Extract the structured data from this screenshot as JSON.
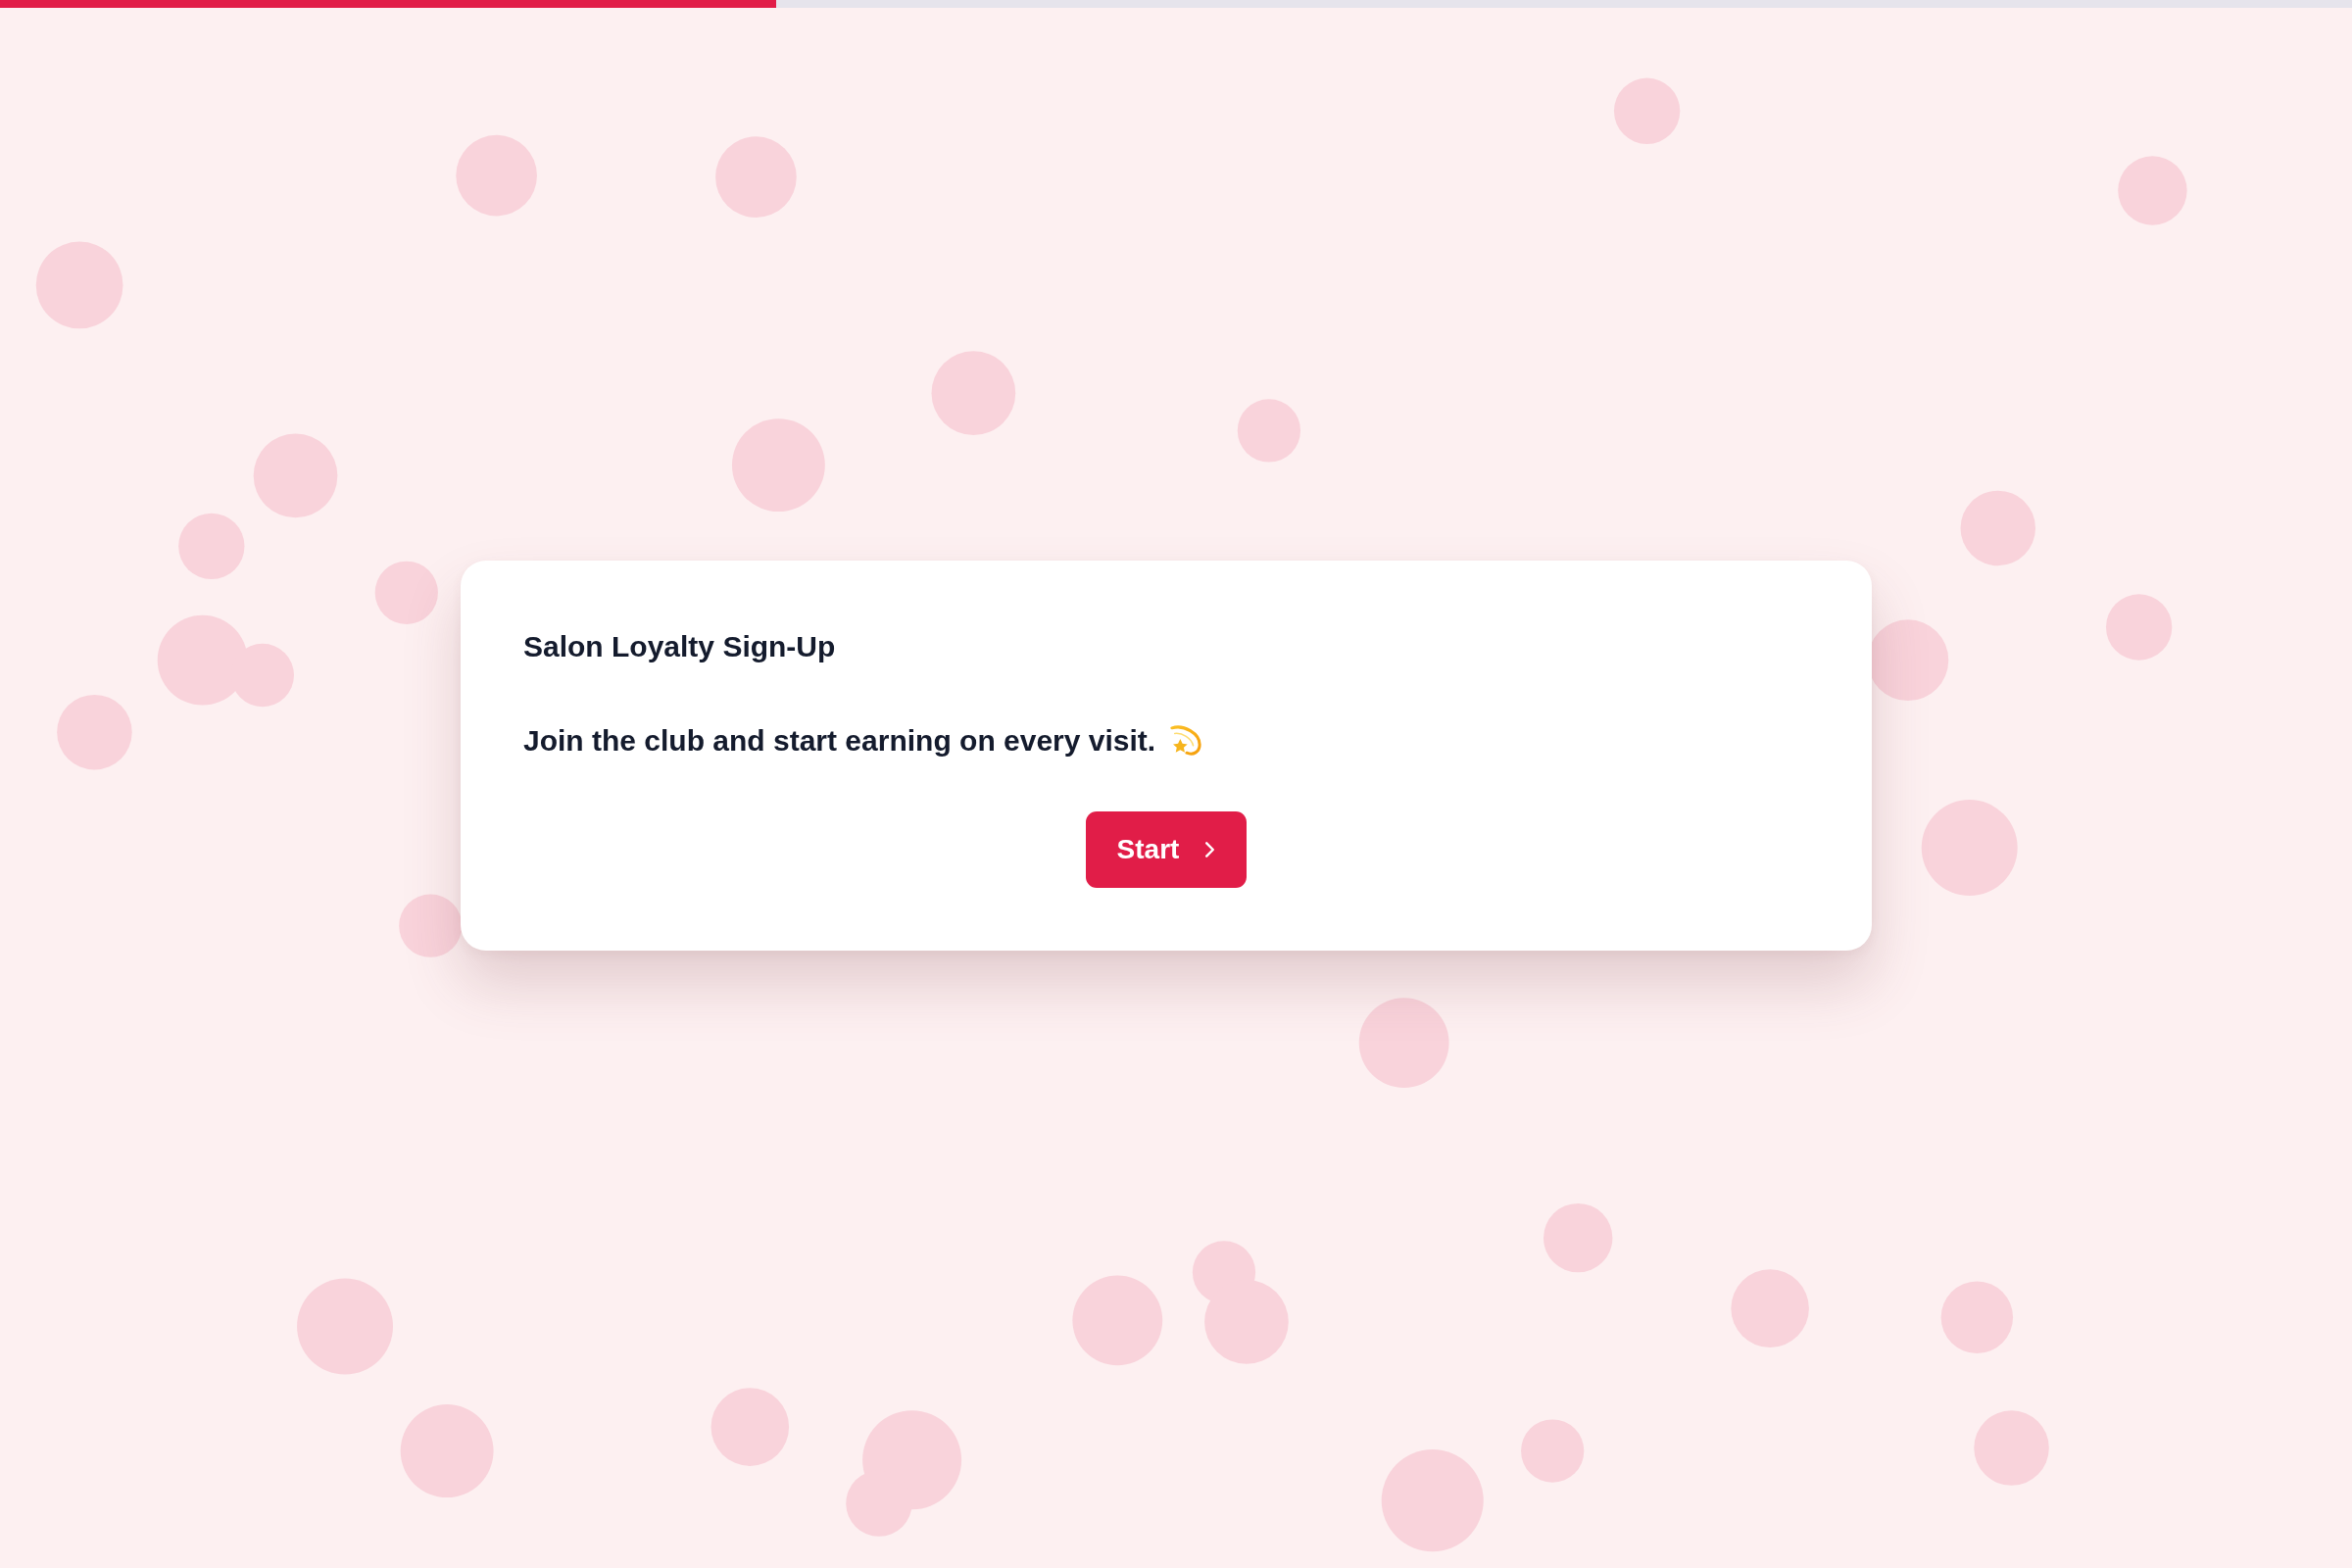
{
  "progress": {
    "level": 0.33
  },
  "card": {
    "title": "Salon Loyalty Sign-Up",
    "message": "Join the club and start earning on every visit.",
    "button": "Start"
  }
}
